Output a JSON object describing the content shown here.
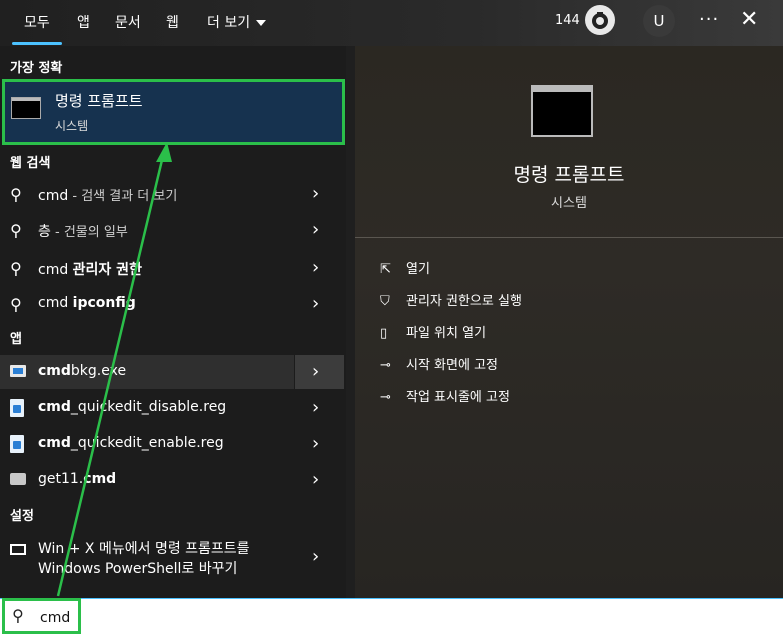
{
  "tabs": [
    {
      "label": "모두"
    },
    {
      "label": "앱"
    },
    {
      "label": "문서"
    },
    {
      "label": "웹"
    },
    {
      "label": "더 보기"
    }
  ],
  "header": {
    "count": "144",
    "avatar_letter": "U",
    "more": "···",
    "close": "✕"
  },
  "sections": {
    "best_match": "가장 정확",
    "web_search": "웹 검색",
    "apps": "앱",
    "settings": "설정"
  },
  "best_match": {
    "title": "명령 프롬프트",
    "subtitle": "시스템"
  },
  "web_results": [
    {
      "bold": "",
      "prefix": "cmd",
      "dim": " - 검색 결과 더 보기"
    },
    {
      "bold": "",
      "prefix": "층",
      "dim": " - 건물의 일부"
    },
    {
      "prefix": "cmd ",
      "bold": "관리자 권한",
      "dim": ""
    },
    {
      "prefix": "cmd ",
      "bold": "ipconfig",
      "dim": ""
    }
  ],
  "apps": [
    {
      "bold": "cmd",
      "rest": "bkg.exe"
    },
    {
      "bold": "cmd",
      "rest": "_quickedit_disable.reg"
    },
    {
      "bold": "cmd",
      "rest": "_quickedit_enable.reg"
    },
    {
      "bold": "cmd",
      "rest": "get11.",
      "order": "rest-first"
    }
  ],
  "setting": {
    "line1": "Win + X 메뉴에서 명령 프롬프트를",
    "line2": "Windows PowerShell로 바꾸기"
  },
  "detail": {
    "title": "명령 프롬프트",
    "subtitle": "시스템"
  },
  "actions": [
    {
      "label": "열기",
      "icon": "open-icon"
    },
    {
      "label": "관리자 권한으로 실행",
      "icon": "shield-icon"
    },
    {
      "label": "파일 위치 열기",
      "icon": "folder-icon"
    },
    {
      "label": "시작 화면에 고정",
      "icon": "pin-icon"
    },
    {
      "label": "작업 표시줄에 고정",
      "icon": "pin-icon"
    }
  ],
  "search": {
    "value": "cmd"
  }
}
